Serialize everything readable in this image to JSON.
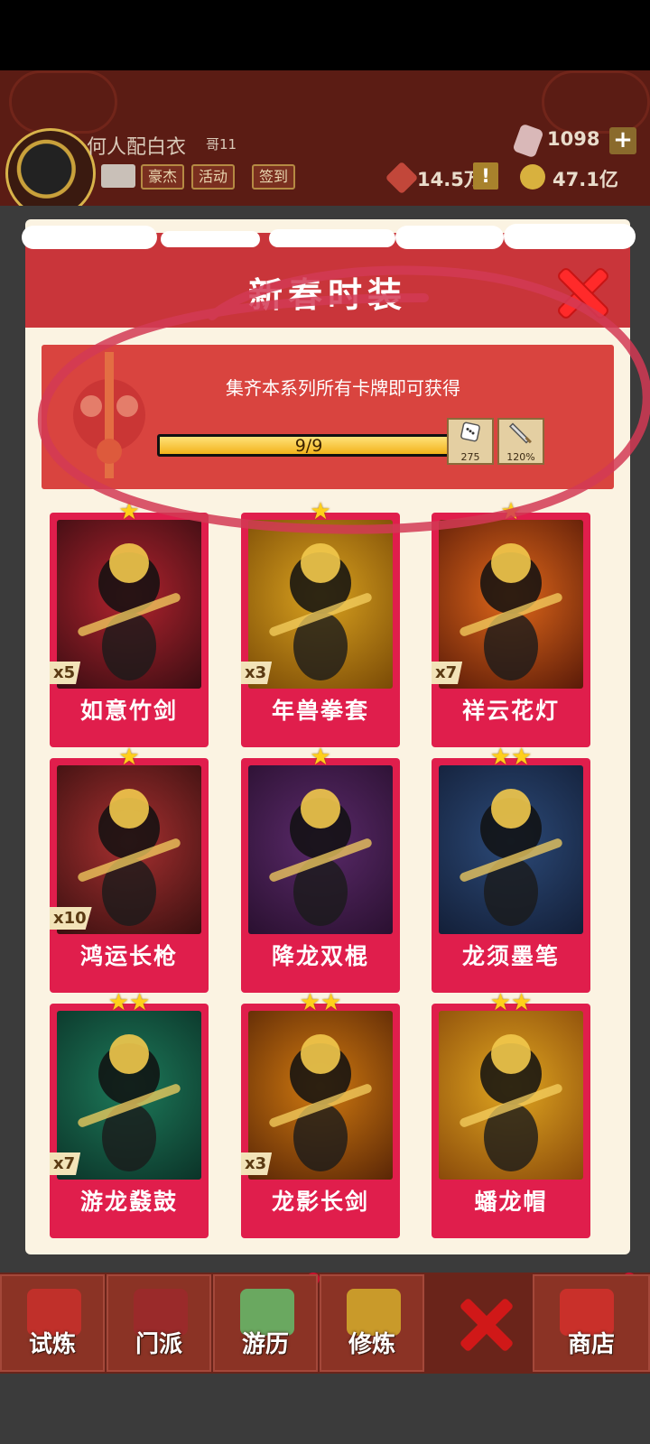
{
  "header": {
    "player_name": "何人配白衣",
    "rank": "哥11",
    "buttons": [
      "豪杰",
      "活动",
      "签到"
    ],
    "gems": "1098",
    "power": "14.5万",
    "gold": "47.1亿",
    "alert": "!"
  },
  "modal": {
    "title": "新春时装",
    "banner_text": "集齐本系列所有卡牌即可获得",
    "progress_label": "9/9",
    "progress_fraction": 1.0,
    "rewards": [
      {
        "icon": "dice-icon",
        "value": "275"
      },
      {
        "icon": "sword-icon",
        "value": "120%"
      }
    ]
  },
  "cards": [
    {
      "name": "如意竹剑",
      "count": "x5",
      "stars": "★",
      "colors": [
        "#b2232e",
        "#3a0d12"
      ]
    },
    {
      "name": "年兽拳套",
      "count": "x3",
      "stars": "★",
      "colors": [
        "#d9a21f",
        "#7a4a06"
      ]
    },
    {
      "name": "祥云花灯",
      "count": "x7",
      "stars": "★",
      "colors": [
        "#e0681a",
        "#5a1a08"
      ]
    },
    {
      "name": "鸿运长枪",
      "count": "x10",
      "stars": "★",
      "colors": [
        "#a83030",
        "#3a1010"
      ]
    },
    {
      "name": "降龙双棍",
      "count": "",
      "stars": "★",
      "colors": [
        "#5a2a6a",
        "#2a1030"
      ]
    },
    {
      "name": "龙须墨笔",
      "count": "",
      "stars": "★★",
      "colors": [
        "#2c4a78",
        "#131f38"
      ]
    },
    {
      "name": "游龙鼗鼓",
      "count": "x7",
      "stars": "★★",
      "colors": [
        "#1d7a5a",
        "#0b3328"
      ]
    },
    {
      "name": "龙影长剑",
      "count": "x3",
      "stars": "★★",
      "colors": [
        "#d07a10",
        "#5a2606"
      ]
    },
    {
      "name": "蟠龙帽",
      "count": "",
      "stars": "★★",
      "colors": [
        "#e0a620",
        "#8a4a0a"
      ]
    }
  ],
  "nav": {
    "items": [
      "试炼",
      "门派",
      "游历",
      "修炼",
      "商店"
    ]
  }
}
